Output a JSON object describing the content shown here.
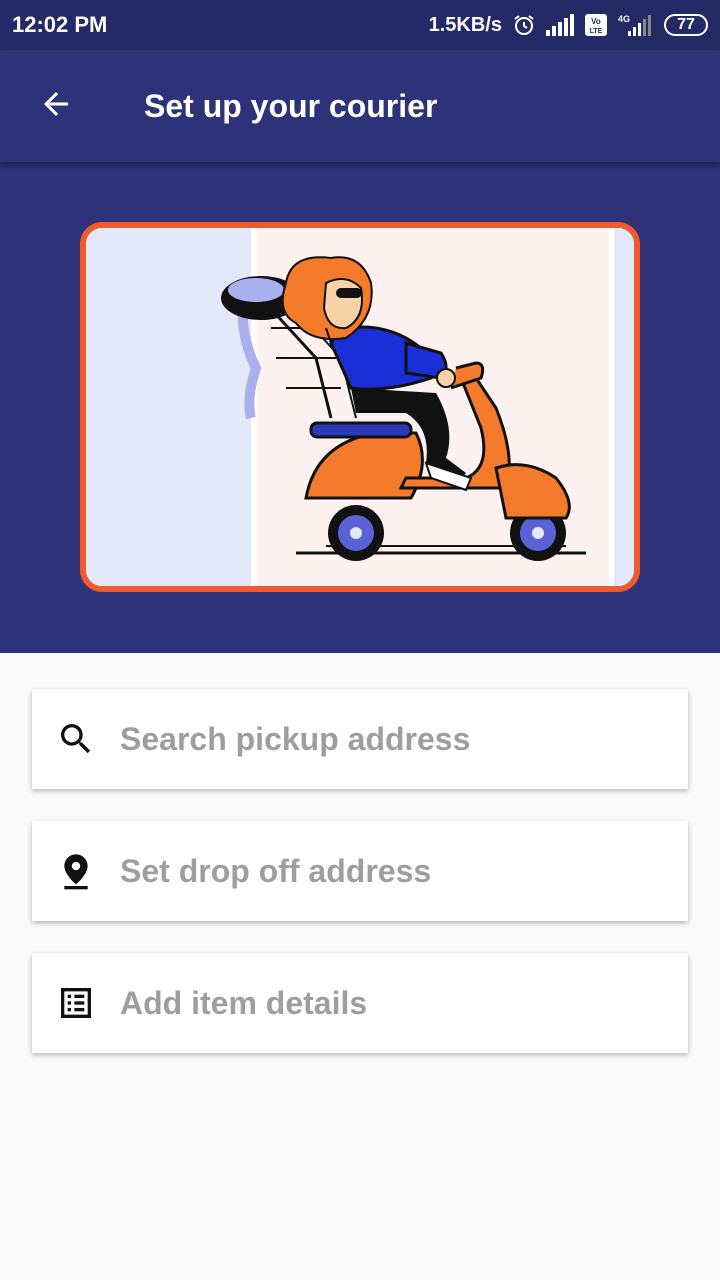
{
  "status_bar": {
    "time": "12:02 PM",
    "net_speed": "1.5KB/s",
    "volte": "Vo LTE",
    "network": "4G",
    "battery": "77"
  },
  "app_bar": {
    "title": "Set up your courier",
    "back_icon": "arrow-left-icon"
  },
  "hero": {
    "image": "courier-scooter-illustration",
    "border_color": "#f15a2b",
    "background_color": "#2e3278"
  },
  "fields": [
    {
      "icon": "search-icon",
      "placeholder": "Search pickup address"
    },
    {
      "icon": "location-pin-icon",
      "placeholder": "Set drop off address"
    },
    {
      "icon": "list-details-icon",
      "placeholder": "Add item details"
    }
  ],
  "colors": {
    "primary": "#2e3278",
    "status_bar": "#242a66",
    "accent": "#f15a2b",
    "placeholder": "#9e9e9e"
  }
}
